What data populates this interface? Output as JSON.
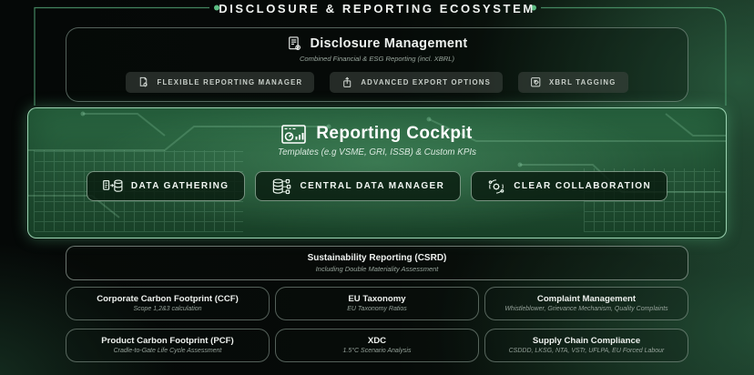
{
  "header": {
    "title": "DISCLOSURE & REPORTING ECOSYSTEM"
  },
  "disclosure_management": {
    "title": "Disclosure Management",
    "subtitle": "Combined Financial & ESG Reporting (incl. XBRL)",
    "buttons": [
      {
        "label": "FLEXIBLE REPORTING MANAGER",
        "icon": "report-settings-icon"
      },
      {
        "label": "ADVANCED EXPORT OPTIONS",
        "icon": "export-icon"
      },
      {
        "label": "XBRL TAGGING",
        "icon": "xbrl-tag-icon"
      }
    ]
  },
  "reporting_cockpit": {
    "title": "Reporting Cockpit",
    "subtitle": "Templates (e.g VSME, GRI, ISSB) & Custom KPIs",
    "buttons": [
      {
        "label": "DATA GATHERING",
        "icon": "data-gathering-icon"
      },
      {
        "label": "CENTRAL DATA MANAGER",
        "icon": "central-database-icon"
      },
      {
        "label": "CLEAR COLLABORATION",
        "icon": "collaboration-icon"
      }
    ]
  },
  "csrd": {
    "title": "Sustainability Reporting (CSRD)",
    "subtitle": "Including Double Materiality Assessment"
  },
  "modules": [
    {
      "title": "Corporate Carbon Footprint (CCF)",
      "subtitle": "Scope 1,2&3 calculation"
    },
    {
      "title": "EU Taxonomy",
      "subtitle": "EU Taxonomy Ratios"
    },
    {
      "title": "Complaint Management",
      "subtitle": "Whistleblower, Grievance Mechanism, Quality Complaints"
    },
    {
      "title": "Product Carbon Footprint (PCF)",
      "subtitle": "Cradle-to-Gate Life Cycle Assessment"
    },
    {
      "title": "XDC",
      "subtitle": "1.5°C Scenario Analysis"
    },
    {
      "title": "Supply Chain Compliance",
      "subtitle": "CSDDD, LKSG, NTA, VSTr, UFLPA, EU Forced Labour"
    }
  ],
  "colors": {
    "background": "#060a08",
    "line_green": "#4f9a6e",
    "dot_green": "#5cbd83",
    "cockpit_fill": "#25603c",
    "cockpit_border": "#a3ddbd",
    "pill_gray": "#40474299",
    "text_primary": "#eef1ef",
    "text_muted": "#97a49b"
  }
}
